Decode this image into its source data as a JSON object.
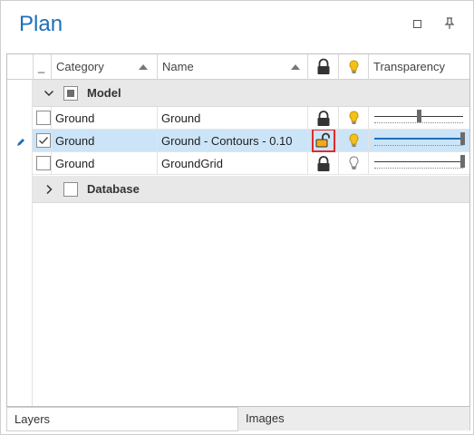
{
  "panel": {
    "title": "Plan",
    "maximize_label": "",
    "pin_label": "†"
  },
  "columns": {
    "indicator": "_",
    "category": "Category",
    "name": "Name",
    "lock": "lock-icon",
    "visible": "lightbulb-icon",
    "transparency": "Transparency"
  },
  "groups": [
    {
      "label": "Model",
      "expanded": true,
      "checked": "mixed"
    },
    {
      "label": "Database",
      "expanded": false,
      "checked": false
    }
  ],
  "rows": [
    {
      "category": "Ground",
      "name": "Ground",
      "checked": false,
      "locked": true,
      "visible": true,
      "transparency": 0.5,
      "selected": false
    },
    {
      "category": "Ground",
      "name": "Ground - Contours - 0.10",
      "checked": true,
      "locked": false,
      "visible": true,
      "transparency": 1.0,
      "selected": true
    },
    {
      "category": "Ground",
      "name": "GroundGrid",
      "checked": false,
      "locked": true,
      "visible": false,
      "transparency": 1.0,
      "selected": false
    }
  ],
  "tabs": [
    {
      "label": "Layers",
      "active": true
    },
    {
      "label": "Images",
      "active": false
    }
  ],
  "colors": {
    "title": "#1e6fb8",
    "selected_row": "#cce4f7",
    "bulb_on": "#f3c11b",
    "highlight": "#e02b2b"
  }
}
